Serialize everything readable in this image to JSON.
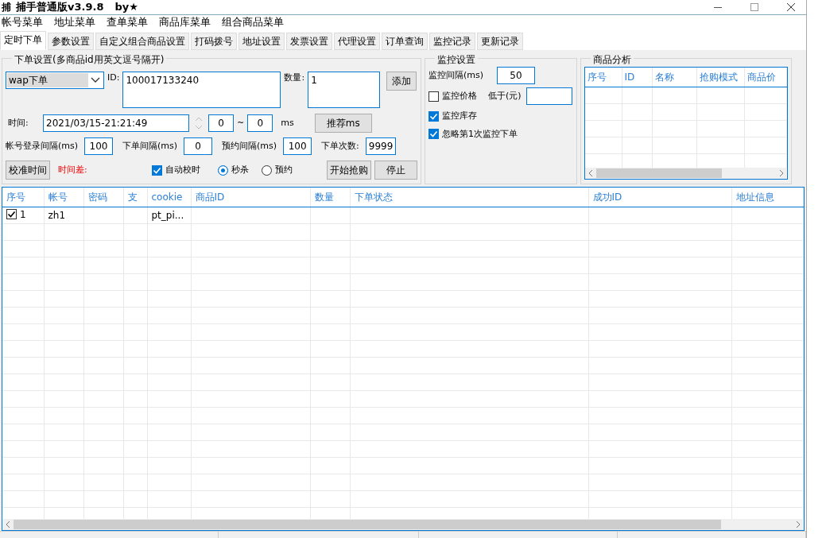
{
  "window": {
    "icon_glyph": "捕",
    "title": "捕手普通版v3.9.8",
    "author": "by★"
  },
  "menu": [
    "帐号菜单",
    "地址菜单",
    "查单菜单",
    "商品库菜单",
    "组合商品菜单"
  ],
  "tabs": [
    {
      "label": "定时下单",
      "selected": true
    },
    {
      "label": "参数设置",
      "selected": false
    },
    {
      "label": "自定义组合商品设置",
      "selected": false
    },
    {
      "label": "打码拨号",
      "selected": false
    },
    {
      "label": "地址设置",
      "selected": false
    },
    {
      "label": "发票设置",
      "selected": false
    },
    {
      "label": "代理设置",
      "selected": false
    },
    {
      "label": "订单查询",
      "selected": false
    },
    {
      "label": "监控记录",
      "selected": false
    },
    {
      "label": "更新记录",
      "selected": false
    }
  ],
  "order_settings": {
    "legend": "下单设置(多商品id用英文逗号隔开)",
    "mode": "wap下单",
    "id_label": "ID:",
    "id_value": "100017133240",
    "qty_label": "数量:",
    "qty_value": "1",
    "add_button": "添加",
    "time_label": "时间:",
    "time_value": "2021/03/15-21:21:49",
    "ms_from": "0",
    "tilde": "~",
    "ms_to": "0",
    "ms_unit": "ms",
    "recommend_button": "推荐ms",
    "intervals": [
      {
        "label": "帐号登录间隔(ms)",
        "value": "100"
      },
      {
        "label": "下单间隔(ms)",
        "value": "0"
      },
      {
        "label": "预约间隔(ms)",
        "value": "100"
      },
      {
        "label": "下单次数:",
        "value": "9999"
      }
    ],
    "calibrate_button": "校准时间",
    "time_diff_label": "时间差:",
    "auto_sync": {
      "label": "自动校时",
      "checked": true
    },
    "modes": [
      {
        "label": "秒杀",
        "selected": true
      },
      {
        "label": "预约",
        "selected": false
      }
    ],
    "start_button": "开始抢购",
    "stop_button": "停止"
  },
  "monitor_settings": {
    "legend": "监控设置",
    "interval_label": "监控间隔(ms)",
    "interval_value": "50",
    "options": [
      {
        "label": "监控价格",
        "checked": false,
        "below_label": "低于(元)"
      },
      {
        "label": "监控库存",
        "checked": true
      },
      {
        "label": "忽略第1次监控下单",
        "checked": true
      }
    ]
  },
  "product_analysis": {
    "legend": "商品分析",
    "columns": [
      "序号",
      "ID",
      "名称",
      "抢购模式",
      "商品价"
    ]
  },
  "table": {
    "columns": [
      "序号",
      "帐号",
      "密码",
      "支",
      "cookie",
      "商品ID",
      "数量",
      "下单状态",
      "成功ID",
      "地址信息"
    ],
    "rows": [
      {
        "checked": true,
        "cells": [
          "1",
          "zh1",
          "",
          "",
          "pt_pi...",
          "",
          "",
          "",
          "",
          ""
        ]
      }
    ]
  }
}
